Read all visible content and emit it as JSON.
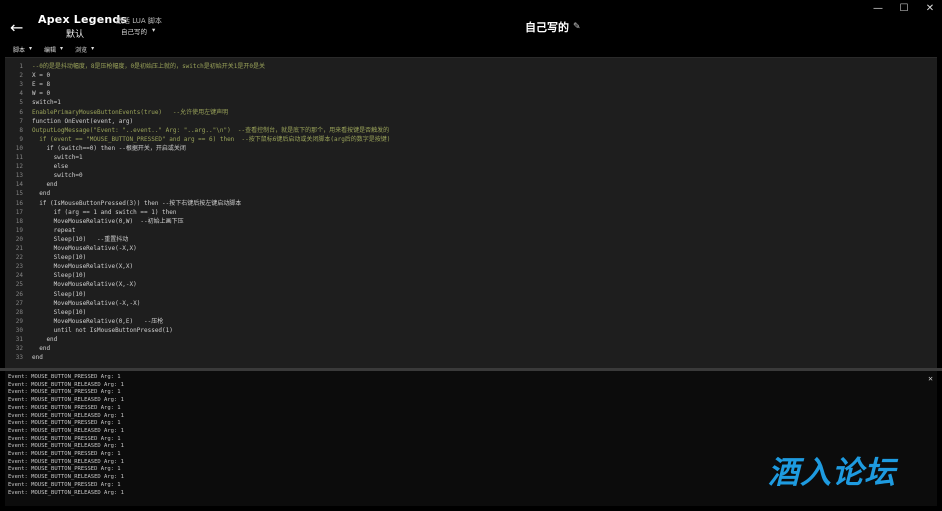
{
  "window": {
    "minimize": "—",
    "maximize": "☐",
    "close": "✕"
  },
  "header": {
    "back_icon": "arrow-left-icon",
    "game_title": "Apex Legends",
    "game_sub": "默认",
    "activate_label": "激活 LUA 脚本",
    "script_name": "自己写的",
    "center_title": "自己写的",
    "edit_icon": "pencil-icon"
  },
  "menu": [
    {
      "label": "脚本",
      "arrow": "▾"
    },
    {
      "label": "编辑",
      "arrow": "▾"
    },
    {
      "label": "浏览",
      "arrow": "▾"
    }
  ],
  "code": [
    {
      "n": "1",
      "t": "--0的是是抖动幅度，8是压枪幅度，0是初始压上就的，switch是初始开关1是开0是关",
      "c": "cc"
    },
    {
      "n": "2",
      "t": "X = 0",
      "c": "cw"
    },
    {
      "n": "3",
      "t": "E = 8",
      "c": "cw"
    },
    {
      "n": "4",
      "t": "W = 0",
      "c": "cw"
    },
    {
      "n": "5",
      "t": "switch=1",
      "c": "cw"
    },
    {
      "n": "6",
      "t": "EnablePrimaryMouseButtonEvents(true)   --允许使用左键声明",
      "c": "cc"
    },
    {
      "n": "7",
      "t": "function OnEvent(event, arg)",
      "c": "cw"
    },
    {
      "n": "8",
      "t": "OutputLogMessage(\"Event: \"..event..\" Arg: \"..arg..\"\\n\")  --查看控制台，就是底下的那个，用来看按键是否触发的",
      "c": "cc"
    },
    {
      "n": "9",
      "t": "  if (event == \"MOUSE_BUTTON_PRESSED\" and arg == 6) then  --按下鼠标6键后启动或关闭脚本(arg后的数字是按键)",
      "c": "cc"
    },
    {
      "n": "10",
      "t": "    if (switch==0) then --根据开关，开启或关闭",
      "c": "cw"
    },
    {
      "n": "11",
      "t": "      switch=1",
      "c": "cw"
    },
    {
      "n": "12",
      "t": "      else",
      "c": "cw"
    },
    {
      "n": "13",
      "t": "      switch=0",
      "c": "cw"
    },
    {
      "n": "14",
      "t": "    end",
      "c": "cw"
    },
    {
      "n": "15",
      "t": "  end",
      "c": "cw"
    },
    {
      "n": "16",
      "t": "  if (IsMouseButtonPressed(3)) then --按下右键后按左键启动脚本",
      "c": "cw"
    },
    {
      "n": "17",
      "t": "      if (arg == 1 and switch == 1) then",
      "c": "cw"
    },
    {
      "n": "18",
      "t": "      MoveMouseRelative(0,W)  --初始上画下压",
      "c": "cw"
    },
    {
      "n": "19",
      "t": "      repeat",
      "c": "cw"
    },
    {
      "n": "20",
      "t": "      Sleep(10)   --重置抖动",
      "c": "cw"
    },
    {
      "n": "21",
      "t": "      MoveMouseRelative(-X,X)",
      "c": "cw"
    },
    {
      "n": "22",
      "t": "      Sleep(10)",
      "c": "cw"
    },
    {
      "n": "23",
      "t": "      MoveMouseRelative(X,X)",
      "c": "cw"
    },
    {
      "n": "24",
      "t": "      Sleep(10)",
      "c": "cw"
    },
    {
      "n": "25",
      "t": "      MoveMouseRelative(X,-X)",
      "c": "cw"
    },
    {
      "n": "26",
      "t": "      Sleep(10)",
      "c": "cw"
    },
    {
      "n": "27",
      "t": "      MoveMouseRelative(-X,-X)",
      "c": "cw"
    },
    {
      "n": "28",
      "t": "      Sleep(10)",
      "c": "cw"
    },
    {
      "n": "29",
      "t": "      MoveMouseRelative(0,E)   --压枪",
      "c": "cw"
    },
    {
      "n": "30",
      "t": "      until not IsMouseButtonPressed(1)",
      "c": "cw"
    },
    {
      "n": "31",
      "t": "    end",
      "c": "cw"
    },
    {
      "n": "32",
      "t": "  end",
      "c": "cw"
    },
    {
      "n": "33",
      "t": "end",
      "c": "cw"
    }
  ],
  "console_close": "✕",
  "console": [
    "Event: MOUSE_BUTTON_PRESSED Arg: 1",
    "Event: MOUSE_BUTTON_RELEASED Arg: 1",
    "Event: MOUSE_BUTTON_PRESSED Arg: 1",
    "Event: MOUSE_BUTTON_RELEASED Arg: 1",
    "Event: MOUSE_BUTTON_PRESSED Arg: 1",
    "Event: MOUSE_BUTTON_RELEASED Arg: 1",
    "Event: MOUSE_BUTTON_PRESSED Arg: 1",
    "Event: MOUSE_BUTTON_RELEASED Arg: 1",
    "Event: MOUSE_BUTTON_PRESSED Arg: 1",
    "Event: MOUSE_BUTTON_RELEASED Arg: 1",
    "Event: MOUSE_BUTTON_PRESSED Arg: 1",
    "Event: MOUSE_BUTTON_RELEASED Arg: 1",
    "Event: MOUSE_BUTTON_PRESSED Arg: 1",
    "Event: MOUSE_BUTTON_RELEASED Arg: 1",
    "Event: MOUSE_BUTTON_PRESSED Arg: 1",
    "Event: MOUSE_BUTTON_RELEASED Arg: 1"
  ],
  "watermark": "酒入论坛"
}
